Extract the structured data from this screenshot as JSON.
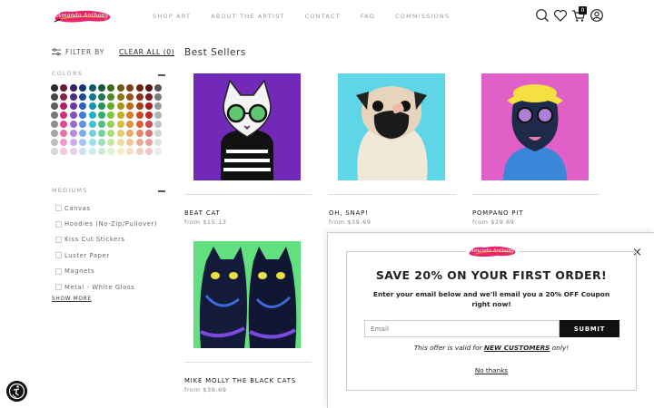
{
  "brand": {
    "logo_text": "Amanda Anthony",
    "logo_color": "#e8256b"
  },
  "nav": [
    {
      "label": "SHOP ART"
    },
    {
      "label": "ABOUT THE ARTIST"
    },
    {
      "label": "CONTACT"
    },
    {
      "label": "FAQ"
    },
    {
      "label": "COMMISSIONS"
    }
  ],
  "header_icons": [
    "search-icon",
    "heart-icon",
    "cart-icon",
    "account-icon"
  ],
  "cart": {
    "count": "0"
  },
  "filters": {
    "filter_label": "FILTER BY",
    "clear_label": "CLEAR ALL (0)",
    "colors_title": "COLORS",
    "mediums_title": "MEDIUMS",
    "swatch_colors": [
      "#2b2b2b",
      "#6b1a3c",
      "#3a1d6e",
      "#14337a",
      "#0e5a6b",
      "#155a3a",
      "#3c6b1d",
      "#6b5a12",
      "#7a3e12",
      "#6b2412",
      "#5a1212",
      "#555555",
      "#454545",
      "#8a1c4e",
      "#4e2a8a",
      "#1c4a9a",
      "#13768a",
      "#1c7a4e",
      "#4e8a22",
      "#8a7616",
      "#9a5216",
      "#8a3016",
      "#7a1a1a",
      "#7a7a7a",
      "#5e5e5e",
      "#b02060",
      "#6a3aaa",
      "#2a62c0",
      "#1a94aa",
      "#22965e",
      "#62aa2a",
      "#aa921a",
      "#c0661a",
      "#aa3a1a",
      "#a02020",
      "#999999",
      "#787878",
      "#d0307a",
      "#8450c8",
      "#3a7ade",
      "#22b0c8",
      "#2cb070",
      "#7ac834",
      "#c8ac22",
      "#de7a22",
      "#c84822",
      "#c22a2a",
      "#b0b0b0",
      "#8e8e8e",
      "#e04a90",
      "#9c6ad8",
      "#5a90e6",
      "#44c0d6",
      "#4cc286",
      "#92d450",
      "#d8be40",
      "#e6903e",
      "#d86240",
      "#d24848",
      "#c4c4c4",
      "#a6a6a6",
      "#e872a8",
      "#b48ae2",
      "#7eaaee",
      "#70d0e0",
      "#72d2a0",
      "#aede78",
      "#e2ce6c",
      "#eea866",
      "#e2866c",
      "#de7272",
      "#d4d4d4",
      "#bebebe",
      "#f09cc4",
      "#ccaeea",
      "#a6c4f4",
      "#9cdeea",
      "#9ee0bc",
      "#c8e8a2",
      "#ecdc9a",
      "#f4c496",
      "#ecaa9a",
      "#e89c9c",
      "#e2e2e2",
      "#d6d6d6",
      "#f6c4dc",
      "#e0cef2",
      "#ccdef8",
      "#c8ecf2",
      "#c8ecd8",
      "#e0f2cc",
      "#f4ecc6",
      "#f8dcc2",
      "#f4ccc4",
      "#f2c6c6",
      "#ececec"
    ],
    "mediums": [
      {
        "label": "Canvas"
      },
      {
        "label": "Hoodies (No-Zip/Pullover)"
      },
      {
        "label": "Kiss Cut Stickers"
      },
      {
        "label": "Luster Paper"
      },
      {
        "label": "Magnets"
      },
      {
        "label": "Metal - White Gloss"
      }
    ],
    "show_more": "SHOW MORE"
  },
  "main": {
    "title": "Best Sellers",
    "products": [
      {
        "title": "BEAT CAT",
        "price": "from $15.13",
        "bg": "#7a2fc0"
      },
      {
        "title": "OH, SNAP!",
        "price": "from $39.69",
        "bg": "#5fd6e8"
      },
      {
        "title": "POMPANO PIT",
        "price": "from $39.69",
        "bg": "#e060c8"
      },
      {
        "title": "MIKE MOLLY THE BLACK CATS",
        "price": "from $39.69",
        "bg": "#62e080"
      }
    ]
  },
  "popup": {
    "heading": "SAVE 20% ON YOUR FIRST ORDER!",
    "subtext": "Enter your email below and we'll email you a 20% OFF Coupon right now!",
    "email_placeholder": "Email",
    "submit_label": "SUBMIT",
    "note_prefix": "This offer is valid for ",
    "note_bold": "NEW CUSTOMERS",
    "note_suffix": " only!",
    "decline_label": "No thanks",
    "close_symbol": "×"
  },
  "accessibility": {
    "icon": "accessibility-icon"
  }
}
